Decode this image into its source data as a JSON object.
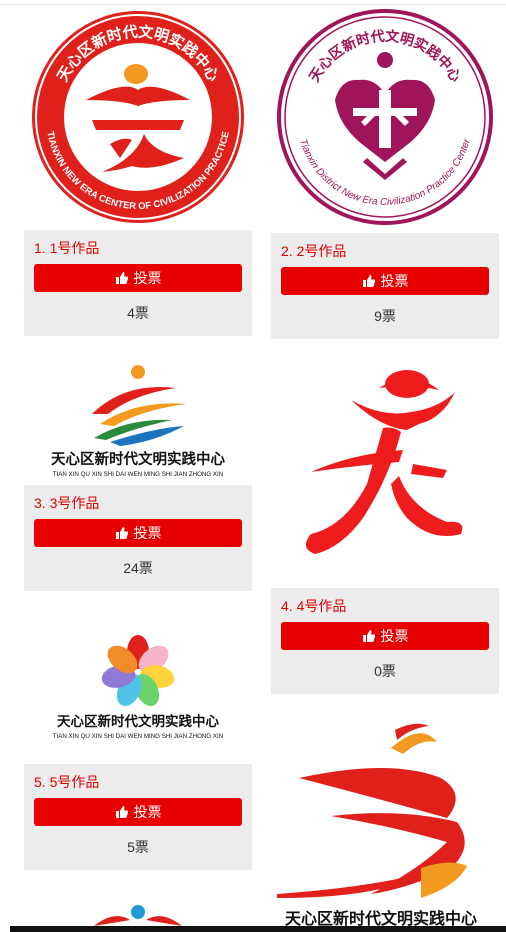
{
  "entries": [
    {
      "title": "1. 1号作品",
      "vote_label": "投票",
      "votes": "4票",
      "logo_cn": "天心区新时代文明实践中心",
      "logo_en": "TIANXIN NEW ERA CENTER OF CIVILIZATION PRACTICE"
    },
    {
      "title": "2. 2号作品",
      "vote_label": "投票",
      "votes": "9票",
      "logo_cn": "天心区新时代文明实践中心",
      "logo_en": "Tianxin District New Era Civilization Practice Center"
    },
    {
      "title": "3. 3号作品",
      "vote_label": "投票",
      "votes": "24票",
      "logo_cn": "天心区新时代文明实践中心",
      "logo_en": "TIAN XIN QU XIN SHI DAI WEN MING SHI JIAN ZHONG XIN"
    },
    {
      "title": "4. 4号作品",
      "vote_label": "投票",
      "votes": "0票"
    },
    {
      "title": "5. 5号作品",
      "vote_label": "投票",
      "votes": "5票",
      "logo_cn": "天心区新时代文明实践中心",
      "logo_en": "TIAN XIN QU XIN SHI DAI WEN MING SHI JIAN ZHONG XIN"
    },
    {
      "logo_cn": "天心区新时代文明实践中心"
    }
  ],
  "colors": {
    "accent": "#e60000",
    "title": "#e00000",
    "panel": "#ececec",
    "maroon": "#a0155a"
  },
  "icons": {
    "vote": "thumbs-up-icon"
  }
}
